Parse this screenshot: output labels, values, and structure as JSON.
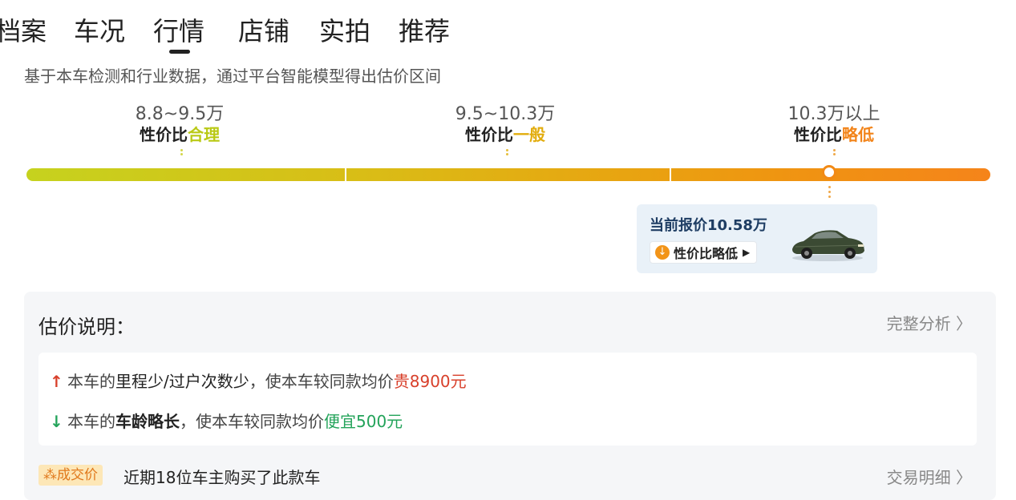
{
  "tabs": [
    {
      "label": "档案"
    },
    {
      "label": "车况"
    },
    {
      "label": "行情",
      "active": true
    },
    {
      "label": "店铺"
    },
    {
      "label": "实拍"
    },
    {
      "label": "推荐"
    }
  ],
  "subtitle": "基于本车检测和行业数据，通过平台智能模型得出估价区间",
  "segments": [
    {
      "range": "8.8~9.5万",
      "prefix": "性价比",
      "rating": "合理",
      "color": "#b9c914"
    },
    {
      "range": "9.5~10.3万",
      "prefix": "性价比",
      "rating": "一般",
      "color": "#e2ac0c"
    },
    {
      "range": "10.3万以上",
      "prefix": "性价比",
      "rating": "略低",
      "color": "#f2841a"
    }
  ],
  "current_price_fraction_on_bar": 0.833,
  "price_card": {
    "text": "当前报价10.58万",
    "pill_label": "性价比略低",
    "pill_icon": "down-arrow-circle-icon"
  },
  "explain": {
    "title": "估价说明：",
    "link": "完整分析 〉",
    "reasons": [
      {
        "direction": "up",
        "prefix": "本车的",
        "highlight": "里程少/过户次数少",
        "mid": "，使本车较同款均价",
        "value": "贵8900元"
      },
      {
        "direction": "down",
        "prefix": "本车的",
        "highlight": "车龄略长",
        "mid": "，使本车较同款均价",
        "value": "便宜500元"
      }
    ]
  },
  "deal": {
    "badge": "成交价",
    "text": "近期18位车主购买了此款车",
    "link": "交易明细 〉"
  },
  "colors": {
    "up": "#d8402b",
    "down": "#23a35a",
    "accent": "#f28a16"
  }
}
